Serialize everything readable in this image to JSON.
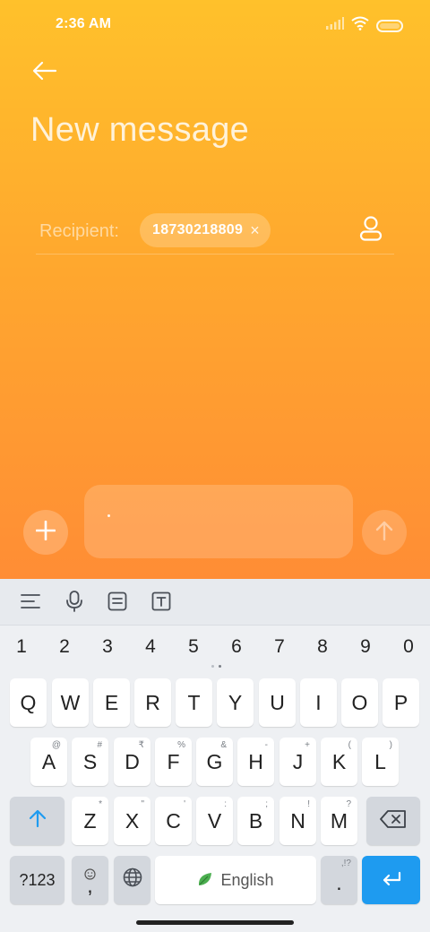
{
  "status_bar": {
    "time": "2:36 AM"
  },
  "header": {
    "title": "New message"
  },
  "recipient": {
    "label": "Recipient:",
    "chip": "18730218809",
    "chip_remove": "×"
  },
  "composer": {
    "message": ""
  },
  "keyboard": {
    "numbers": [
      "1",
      "2",
      "3",
      "4",
      "5",
      "6",
      "7",
      "8",
      "9",
      "0"
    ],
    "row1": [
      "Q",
      "W",
      "E",
      "R",
      "T",
      "Y",
      "U",
      "I",
      "O",
      "P"
    ],
    "row2": [
      "A",
      "S",
      "D",
      "F",
      "G",
      "H",
      "J",
      "K",
      "L"
    ],
    "row2_hints": [
      "@",
      "#",
      "₹",
      "%",
      "&",
      "-",
      "+",
      "(",
      ")"
    ],
    "row3": [
      "Z",
      "X",
      "C",
      "V",
      "B",
      "N",
      "M"
    ],
    "row3_hints": [
      "*",
      "\"",
      "'",
      ":",
      ";",
      "!",
      "?"
    ],
    "symbols_key": "?123",
    "emoji_comma": ",",
    "space_label": "English",
    "period": ".",
    "period_hint": ",!?"
  },
  "colors": {
    "accent_blue": "#1e9bf0",
    "gradient_top": "#ffc12b",
    "gradient_bottom": "#ff8d35"
  }
}
